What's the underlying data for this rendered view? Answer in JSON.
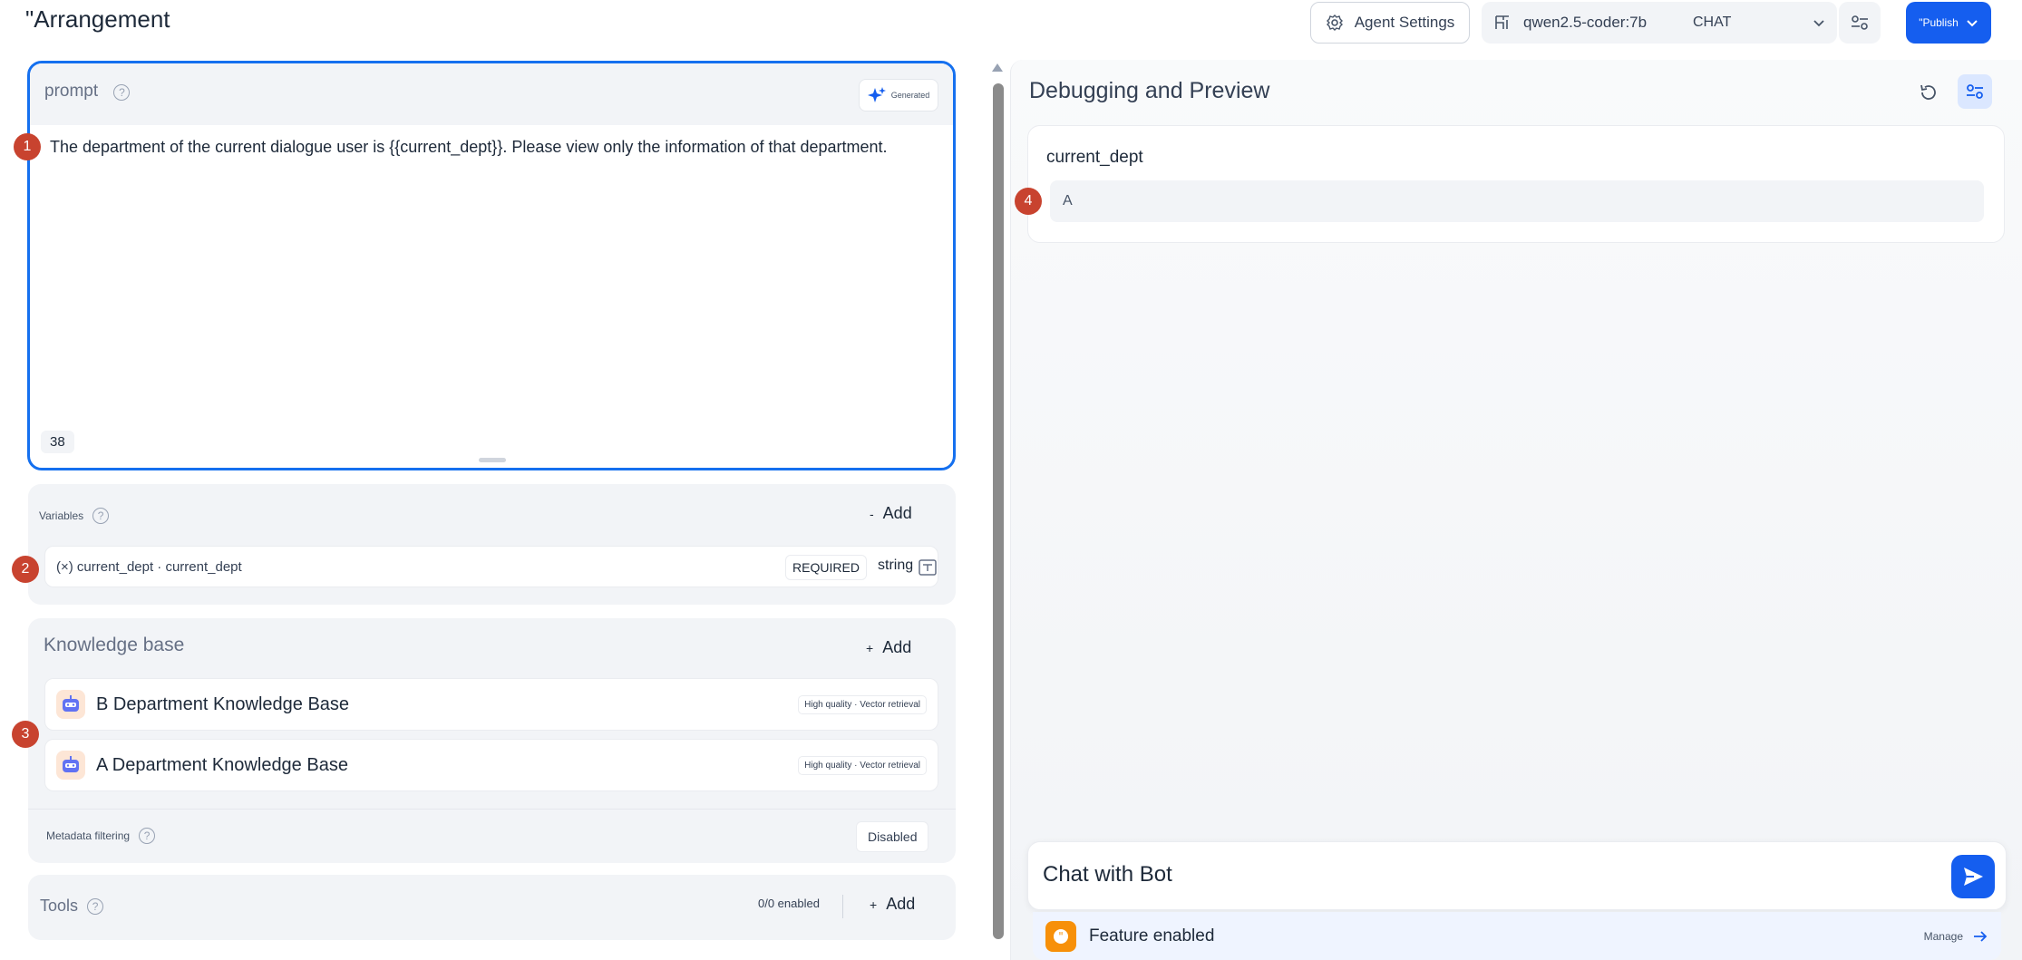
{
  "header": {
    "title": "\"Arrangement",
    "agent_settings_label": "Agent Settings",
    "model_name": "qwen2.5-coder:7b",
    "model_mode": "CHAT",
    "publish_label": "\"Publish"
  },
  "prompt": {
    "label": "prompt",
    "generate_label": "Generated",
    "text": "The department of the current dialogue user is {{current_dept}}. Please view only the information of that department.",
    "char_count": "38"
  },
  "badges": [
    "1",
    "2",
    "3",
    "4"
  ],
  "variables": {
    "label": "Variables",
    "add_label": "Add",
    "items": [
      {
        "text": "(×) current_dept · current_dept",
        "required": "REQUIRED",
        "type": "string"
      }
    ]
  },
  "knowledge": {
    "label": "Knowledge base",
    "add_label": "Add",
    "items": [
      {
        "name": "B Department Knowledge Base",
        "tag": "High quality · Vector retrieval"
      },
      {
        "name": "A Department Knowledge Base",
        "tag": "High quality · Vector retrieval"
      }
    ],
    "metadata_label": "Metadata filtering",
    "metadata_value": "Disabled"
  },
  "tools": {
    "label": "Tools",
    "count": "0/0 enabled",
    "add_label": "Add"
  },
  "debug": {
    "title": "Debugging and Preview",
    "var_label": "current_dept",
    "var_value": "A",
    "chat_placeholder": "Chat with Bot",
    "feature_text": "Feature enabled",
    "manage_label": "Manage"
  },
  "colors": {
    "accent": "#155eef",
    "badge": "#c8432f",
    "focus_border": "#1570ef"
  }
}
